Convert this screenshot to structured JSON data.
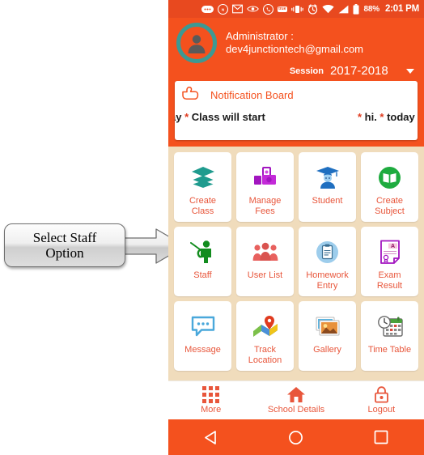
{
  "status_bar": {
    "icons": [
      "dots-message-icon",
      "news-icon",
      "gmail-icon",
      "eye-icon",
      "whatsapp-icon",
      "truecaller-icon",
      "vibrate-icon",
      "alarm-icon",
      "wifi-icon",
      "signal-icon",
      "battery-icon"
    ],
    "news_badge": "NEWS",
    "true_badge": "true",
    "battery_percent": "88%",
    "clock": "2:01 PM"
  },
  "header": {
    "avatar_icon": "user-avatar-icon",
    "role_line": "Administrator :",
    "email_line": "dev4junctiontech@gmail.com",
    "session_label": "Session",
    "session_value": "2017-2018",
    "session_caret_icon": "chevron-down-icon"
  },
  "notification": {
    "pointer_icon": "pointing-hand-icon",
    "title": "Notification Board",
    "marquee_left_pre": "ay ",
    "marquee_left_star": "*",
    "marquee_left_post": " Class will start",
    "marquee_right_star1": "*",
    "marquee_right_mid": " hi. ",
    "marquee_right_star2": "*",
    "marquee_right_post": " today i"
  },
  "grid": {
    "tiles": [
      {
        "label": "Create\nClass",
        "icon": "layers-icon",
        "color": "#1f9b8e"
      },
      {
        "label": "Manage\nFees",
        "icon": "money-icon",
        "color": "#a216c0"
      },
      {
        "label": "Student",
        "icon": "graduate-icon",
        "color": "#1f6fc0"
      },
      {
        "label": "Create\nSubject",
        "icon": "open-book-icon",
        "color": "#1eab3f"
      },
      {
        "label": "Staff",
        "icon": "teacher-pointer-icon",
        "color": "#128c1e"
      },
      {
        "label": "User List",
        "icon": "people-group-icon",
        "color": "#e8615e"
      },
      {
        "label": "Homework\nEntry",
        "icon": "clipboard-icon",
        "color": "#4aa8db"
      },
      {
        "label": "Exam\nResult",
        "icon": "result-sheet-icon",
        "color": "#a216c0"
      },
      {
        "label": "Message",
        "icon": "chat-bubble-icon",
        "color": "#4aa8db"
      },
      {
        "label": "Track\nLocation",
        "icon": "map-pin-icon",
        "color": "#e03b1f"
      },
      {
        "label": "Gallery",
        "icon": "photos-icon",
        "color": "#e8913b"
      },
      {
        "label": "Time Table",
        "icon": "calendar-clock-icon",
        "color": "#5a5a5a"
      }
    ]
  },
  "bottom_nav": {
    "items": [
      {
        "label": "More",
        "icon": "grid-dots-icon"
      },
      {
        "label": "School Details",
        "icon": "home-icon"
      },
      {
        "label": "Logout",
        "icon": "lock-icon"
      }
    ]
  },
  "system_bar": {
    "back_icon": "back-triangle-icon",
    "home_icon": "home-circle-icon",
    "recents_icon": "recents-square-icon"
  },
  "annotation": {
    "text": "Select Staff\nOption",
    "arrow_icon": "right-arrow-icon"
  },
  "colors": {
    "brand_orange": "#f4511e",
    "status_orange": "#e8491f",
    "page_background": "#f0dcbc",
    "tile_background": "#ffffff",
    "label_red": "#e8563b",
    "avatar_ring_teal": "#3d9993"
  }
}
